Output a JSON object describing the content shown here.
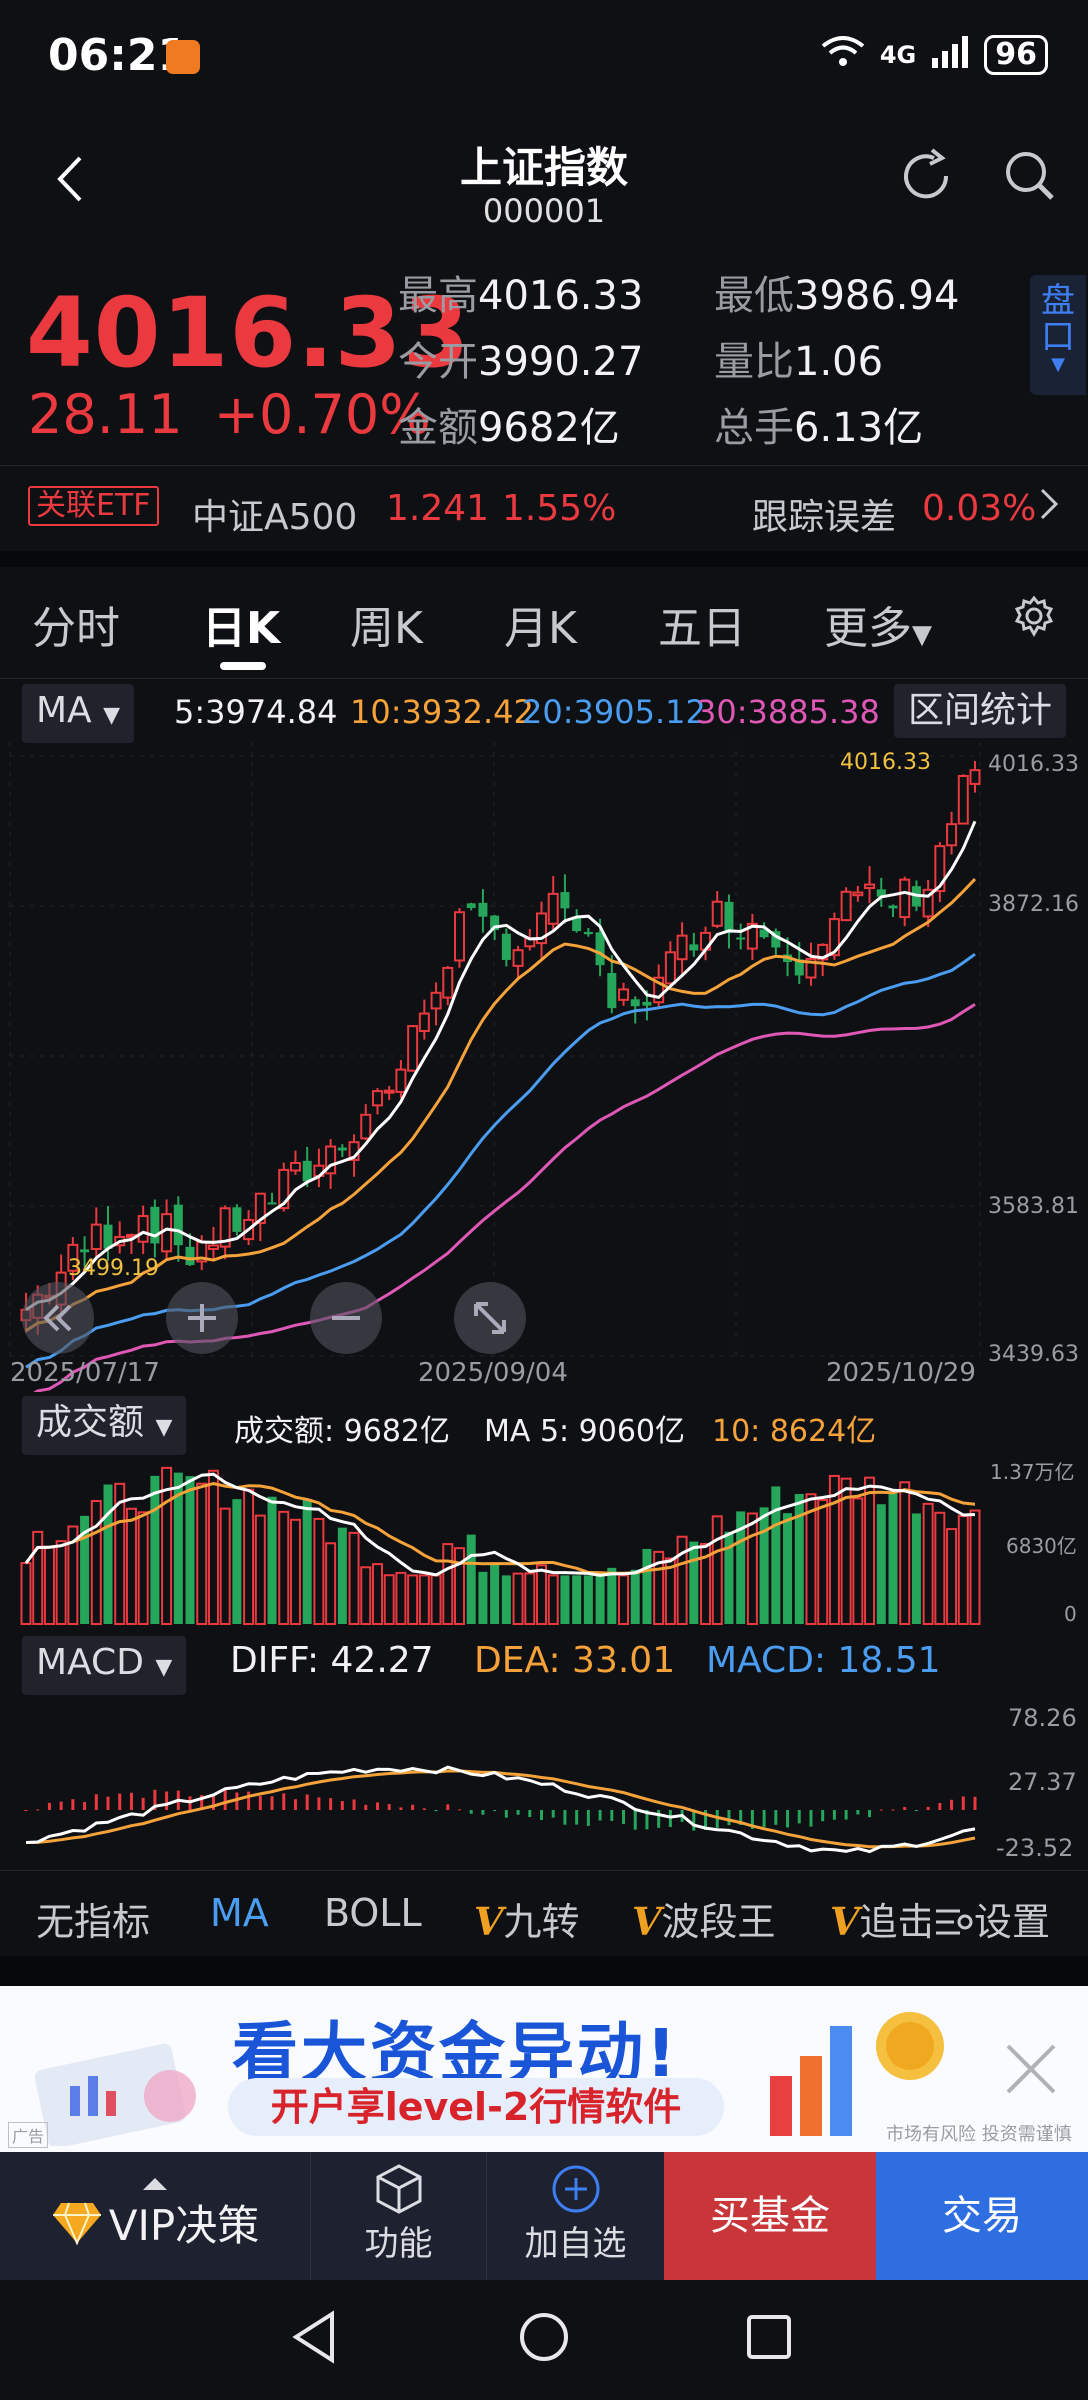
{
  "status_bar": {
    "time": "06:21",
    "network": "4G",
    "signal_small": "6",
    "battery": "96"
  },
  "header": {
    "title": "上证指数",
    "code": "000001"
  },
  "quote": {
    "price": "4016.33",
    "change": "28.11",
    "change_pct": "+0.70%",
    "stats": [
      {
        "label": "最高",
        "value": "4016.33"
      },
      {
        "label": "最低",
        "value": "3986.94"
      },
      {
        "label": "今开",
        "value": "3990.27"
      },
      {
        "label": "量比",
        "value": "1.06"
      },
      {
        "label": "金额",
        "value": "9682亿"
      },
      {
        "label": "总手",
        "value": "6.13亿"
      }
    ],
    "pan_label": "盘口"
  },
  "etf": {
    "badge": "关联ETF",
    "name": "中证A500",
    "price": "1.241",
    "pct": "1.55%",
    "track_label": "跟踪误差",
    "track_value": "0.03%"
  },
  "tabs": [
    "分时",
    "日K",
    "周K",
    "月K",
    "五日",
    "更多"
  ],
  "ma_row": {
    "selector": "MA",
    "ma5": "5:3974.84",
    "ma10": "10:3932.42",
    "ma20": "20:3905.12",
    "ma30": "30:3885.38",
    "range_stats": "区间统计"
  },
  "kline_chart": {
    "y_labels": [
      "4016.33",
      "3872.16",
      "3583.81",
      "3439.63"
    ],
    "high_label": "4016.33",
    "low_label": "3499.19",
    "dates": [
      "2025/07/17",
      "2025/09/04",
      "2025/10/29"
    ]
  },
  "volume": {
    "selector": "成交额",
    "label": "成交额: 9682亿",
    "ma5": "MA 5: 9060亿",
    "ma10": "10: 8624亿",
    "y_labels": [
      "1.37万亿",
      "6830亿",
      "0"
    ]
  },
  "macd": {
    "selector": "MACD",
    "diff": "DIFF: 42.27",
    "dea": "DEA: 33.01",
    "macd": "MACD: 18.51",
    "y_labels": [
      "78.26",
      "27.37",
      "-23.52"
    ]
  },
  "indicators": [
    "无指标",
    "MA",
    "BOLL",
    "九转",
    "波段王",
    "追击",
    "设置"
  ],
  "ad": {
    "title": "看大资金异动!",
    "subtitle": "开户享level-2行情软件",
    "risk": "市场有风险 投资需谨慎",
    "tag": "广告"
  },
  "bottom_nav": {
    "vip": "VIP决策",
    "func": "功能",
    "add": "加自选",
    "buy": "买基金",
    "trade": "交易"
  },
  "colors": {
    "up": "#ea3a3f",
    "down": "#26a65b",
    "ma5": "#ffffff",
    "ma10": "#f5a23a",
    "ma20": "#4a9df0",
    "ma30": "#e058b6"
  }
}
